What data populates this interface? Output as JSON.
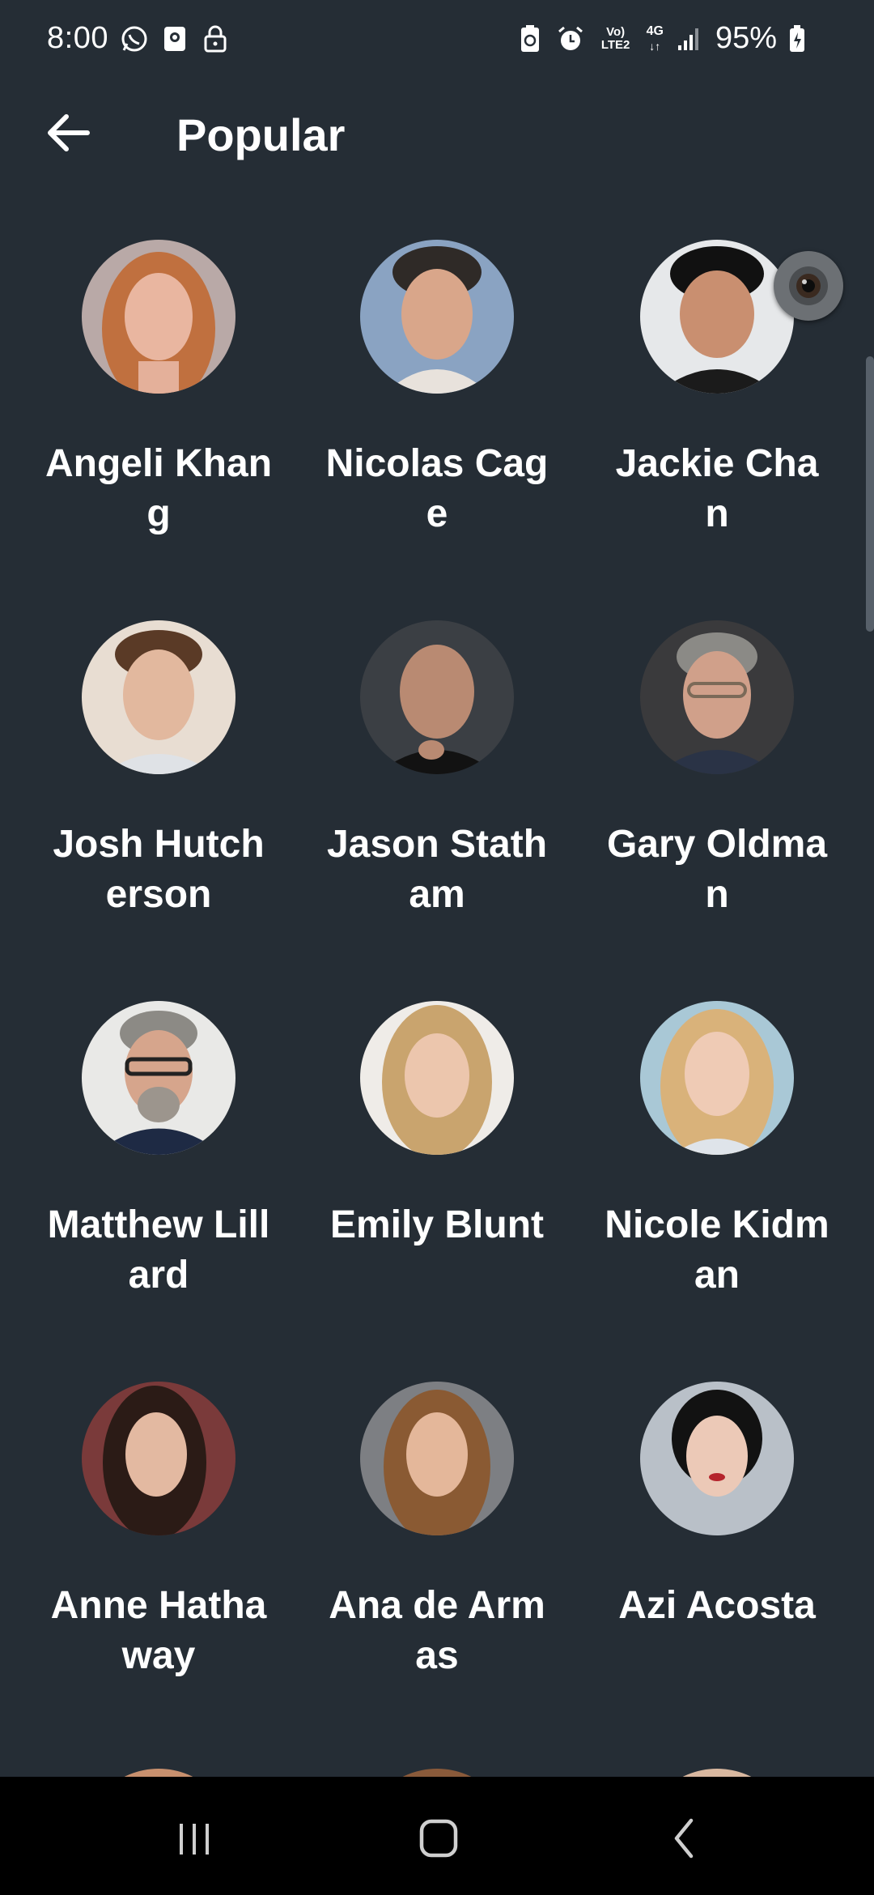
{
  "status_bar": {
    "time": "8:00",
    "battery_percent": "95%",
    "network": "4G",
    "lte_label": "Vo) LTE2",
    "left_icons": [
      "whatsapp-icon",
      "screen-record-icon",
      "lock-icon"
    ],
    "right_icons": [
      "battery-saver-icon",
      "alarm-icon",
      "volte-icon",
      "signal-icon",
      "battery-icon"
    ]
  },
  "app_bar": {
    "title": "Popular",
    "back_icon": "arrow-back-icon"
  },
  "people": [
    {
      "name": "Angeli Khang"
    },
    {
      "name": "Nicolas Cage"
    },
    {
      "name": "Jackie Chan"
    },
    {
      "name": "Josh Hutcherson"
    },
    {
      "name": "Jason Statham"
    },
    {
      "name": "Gary Oldman"
    },
    {
      "name": "Matthew Lillard"
    },
    {
      "name": "Emily Blunt"
    },
    {
      "name": "Nicole Kidman"
    },
    {
      "name": "Anne Hathaway"
    },
    {
      "name": "Ana de Armas"
    },
    {
      "name": "Azi Acosta"
    }
  ],
  "colors": {
    "background": "#252d35",
    "text": "#ffffff",
    "nav_bar": "#000000"
  },
  "nav_bar": {
    "buttons": [
      "recent-apps-icon",
      "home-icon",
      "back-icon"
    ]
  }
}
